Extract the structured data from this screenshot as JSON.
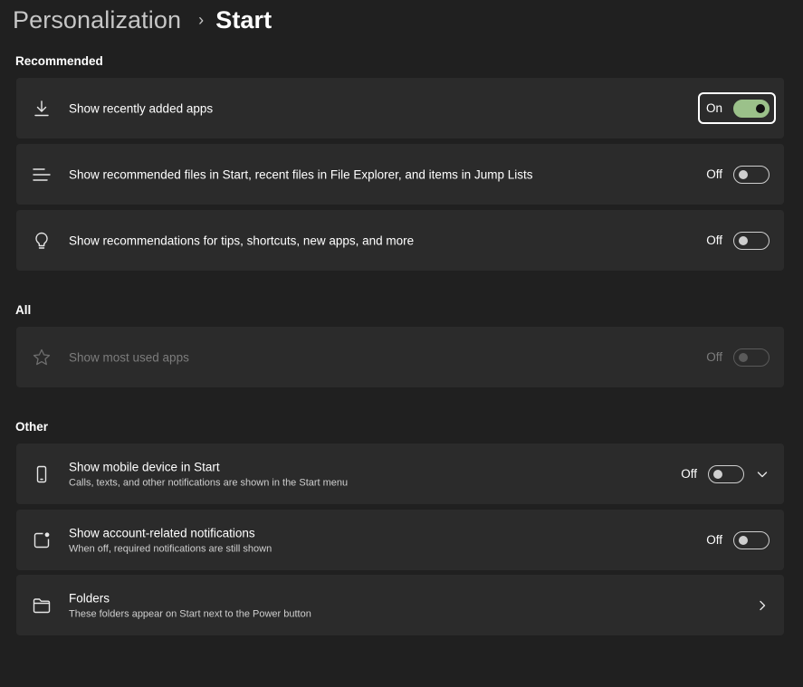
{
  "breadcrumb": {
    "parent": "Personalization",
    "separator": "›",
    "current": "Start"
  },
  "sections": {
    "recommended": "Recommended",
    "all": "All",
    "other": "Other"
  },
  "settings": {
    "recently_added": {
      "icon": "download-icon",
      "title": "Show recently added apps",
      "state_label": "On",
      "state": "on"
    },
    "recommended_files": {
      "icon": "list-icon",
      "title": "Show recommended files in Start, recent files in File Explorer, and items in Jump Lists",
      "state_label": "Off",
      "state": "off"
    },
    "recommendations_tips": {
      "icon": "lightbulb-icon",
      "title": "Show recommendations for tips, shortcuts, new apps, and more",
      "state_label": "Off",
      "state": "off"
    },
    "most_used": {
      "icon": "star-icon",
      "title": "Show most used apps",
      "state_label": "Off",
      "state": "off",
      "disabled": true
    },
    "mobile_device": {
      "icon": "phone-icon",
      "title": "Show mobile device in Start",
      "subtitle": "Calls, texts, and other notifications are shown in the Start menu",
      "state_label": "Off",
      "state": "off"
    },
    "account_notifications": {
      "icon": "notification-badge-icon",
      "title": "Show account-related notifications",
      "subtitle": "When off, required notifications are still shown",
      "state_label": "Off",
      "state": "off"
    },
    "folders": {
      "icon": "folder-icon",
      "title": "Folders",
      "subtitle": "These folders appear on Start next to the Power button"
    }
  },
  "colors": {
    "background": "#202020",
    "card": "#2b2b2b",
    "accent_on": "#9bc18a",
    "text_disabled": "#7c7c7c"
  }
}
